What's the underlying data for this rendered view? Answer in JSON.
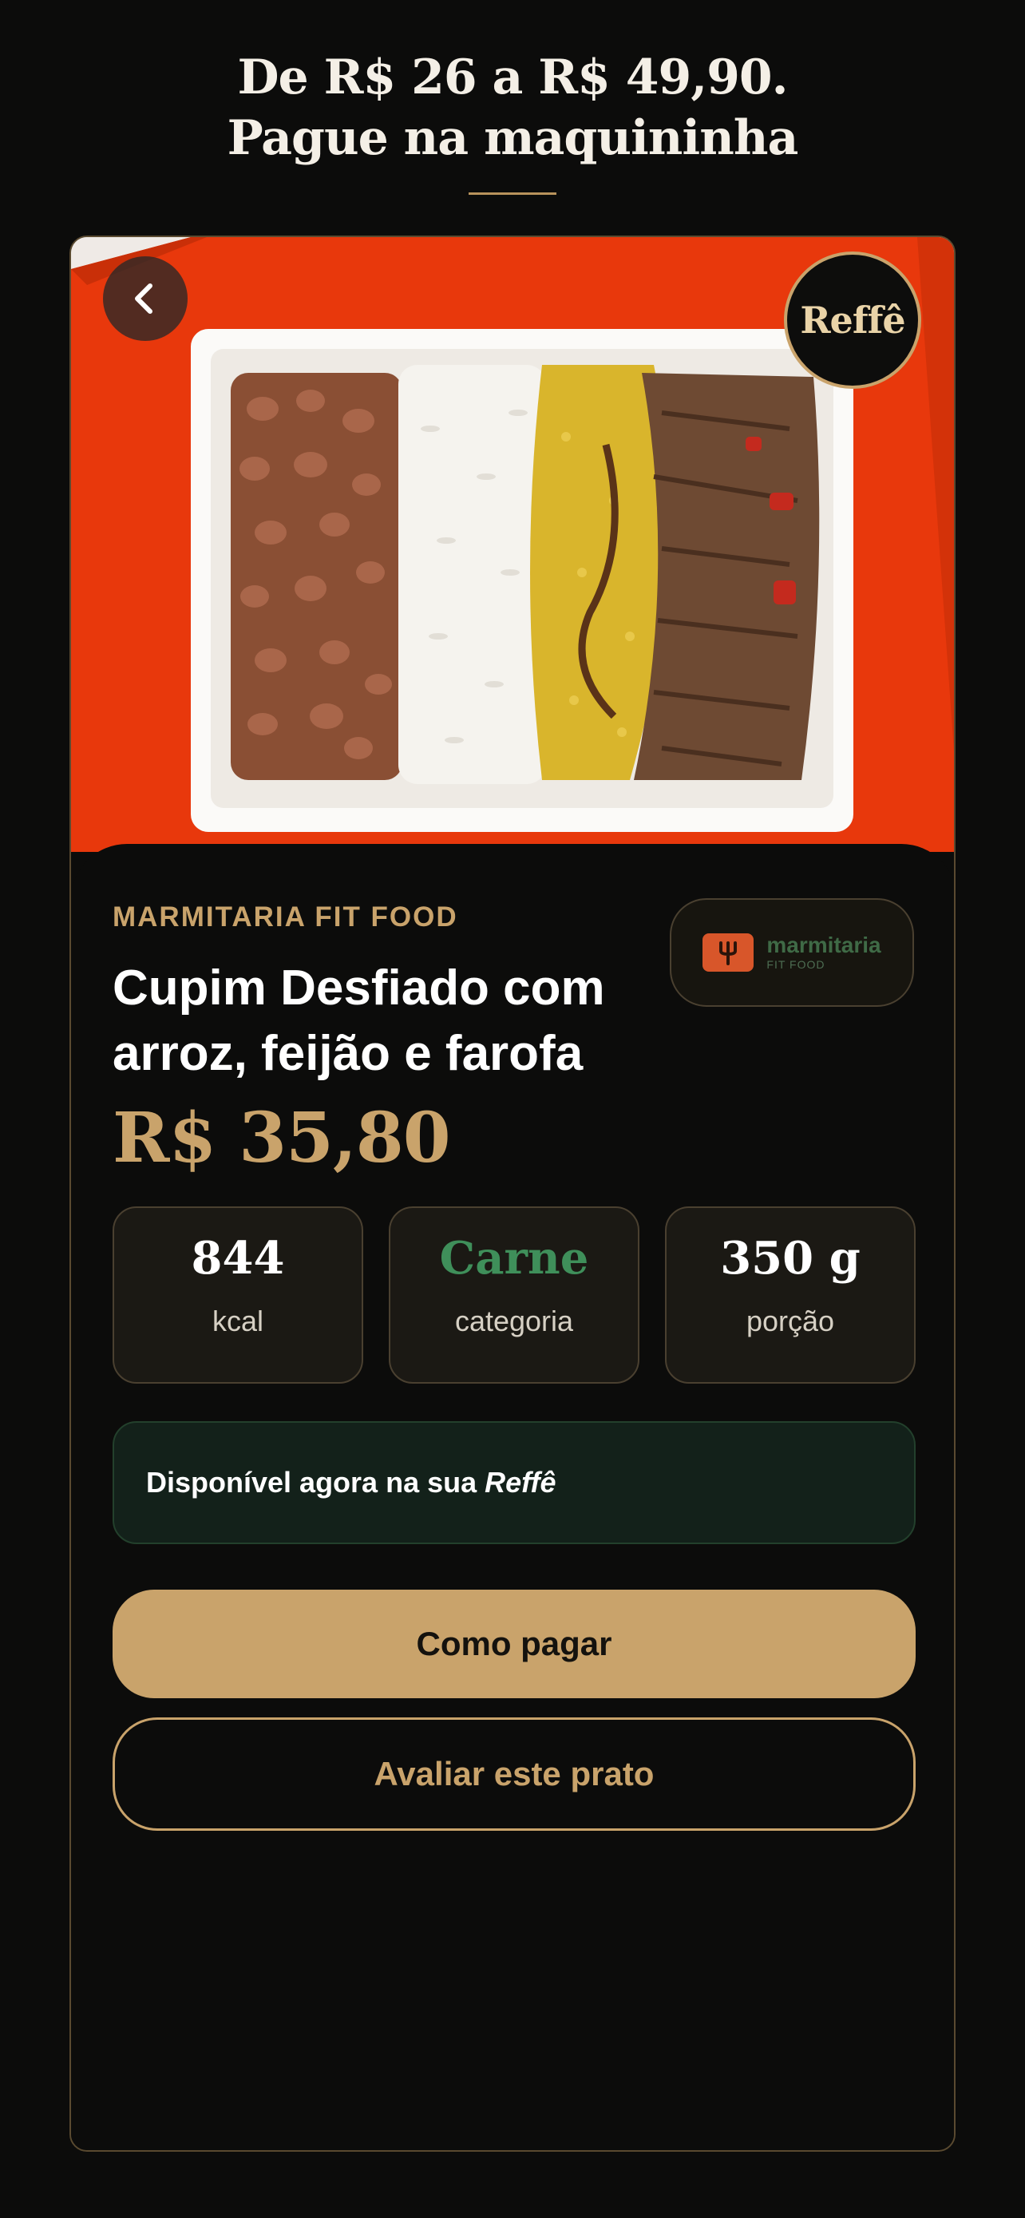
{
  "header": {
    "line1": "De R$ 26 a R$ 49,90.",
    "line2": "Pague na maquininha"
  },
  "brand": {
    "name": "Reffê"
  },
  "product": {
    "vendor": "MARMITARIA FIT FOOD",
    "vendor_logo_name": "marmitaria",
    "vendor_logo_sub": "FIT FOOD",
    "title": "Cupim Desfiado com arroz, feijão e farofa",
    "price": "R$ 35,80"
  },
  "stats": [
    {
      "value": "844",
      "label": "kcal"
    },
    {
      "value": "Carne",
      "label": "categoria"
    },
    {
      "value": "350 g",
      "label": "porção"
    }
  ],
  "availability": {
    "text": "Disponível agora na sua",
    "brand": "Reffê"
  },
  "actions": {
    "primary_label": "Como pagar",
    "secondary_label": "Avaliar este prato"
  },
  "colors": {
    "accent": "#c9a36b",
    "background": "#0c0c0b",
    "category_green": "#3f8f5a",
    "napkin_red": "#e8380c"
  },
  "icons": {
    "back": "chevron-left-icon",
    "vendor": "fork-icon"
  }
}
